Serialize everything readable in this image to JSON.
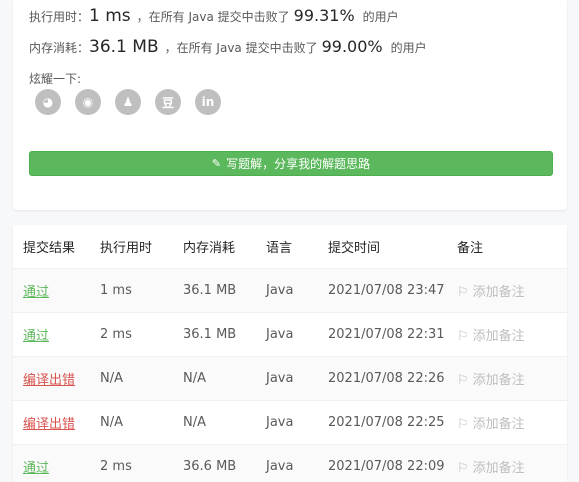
{
  "stats": {
    "runtime": {
      "label": "执行用时：",
      "value": "1 ms",
      "mid": "，在所有 Java 提交中击败了",
      "pct": "99.31%",
      "suffix": "的用户"
    },
    "memory": {
      "label": "内存消耗：",
      "value": "36.1 MB",
      "mid": "，在所有 Java 提交中击败了",
      "pct": "99.00%",
      "suffix": "的用户"
    }
  },
  "share": {
    "label": "炫耀一下:",
    "icons": [
      {
        "name": "wechat-icon",
        "glyph": "◕"
      },
      {
        "name": "weibo-icon",
        "glyph": "◉"
      },
      {
        "name": "qq-icon",
        "glyph": "♟"
      },
      {
        "name": "douban-icon",
        "glyph": "豆"
      },
      {
        "name": "linkedin-icon",
        "glyph": "in"
      }
    ]
  },
  "solution_button": {
    "label": "写题解，分享我的解题思路"
  },
  "table": {
    "headers": [
      "提交结果",
      "执行用时",
      "内存消耗",
      "语言",
      "提交时间",
      "备注"
    ],
    "rows": [
      {
        "status": "通过",
        "ok": true,
        "time": "1 ms",
        "memory": "36.1 MB",
        "lang": "Java",
        "submitted": "2021/07/08 23:47",
        "note": "添加备注"
      },
      {
        "status": "通过",
        "ok": true,
        "time": "2 ms",
        "memory": "36.1 MB",
        "lang": "Java",
        "submitted": "2021/07/08 22:31",
        "note": "添加备注"
      },
      {
        "status": "编译出错",
        "ok": false,
        "time": "N/A",
        "memory": "N/A",
        "lang": "Java",
        "submitted": "2021/07/08 22:26",
        "note": "添加备注"
      },
      {
        "status": "编译出错",
        "ok": false,
        "time": "N/A",
        "memory": "N/A",
        "lang": "Java",
        "submitted": "2021/07/08 22:25",
        "note": "添加备注"
      },
      {
        "status": "通过",
        "ok": true,
        "time": "2 ms",
        "memory": "36.6 MB",
        "lang": "Java",
        "submitted": "2021/07/08 22:09",
        "note": "添加备注"
      }
    ]
  },
  "colors": {
    "pass": "#5cb85c",
    "fail": "#d9534f",
    "button": "#5cb85c"
  }
}
